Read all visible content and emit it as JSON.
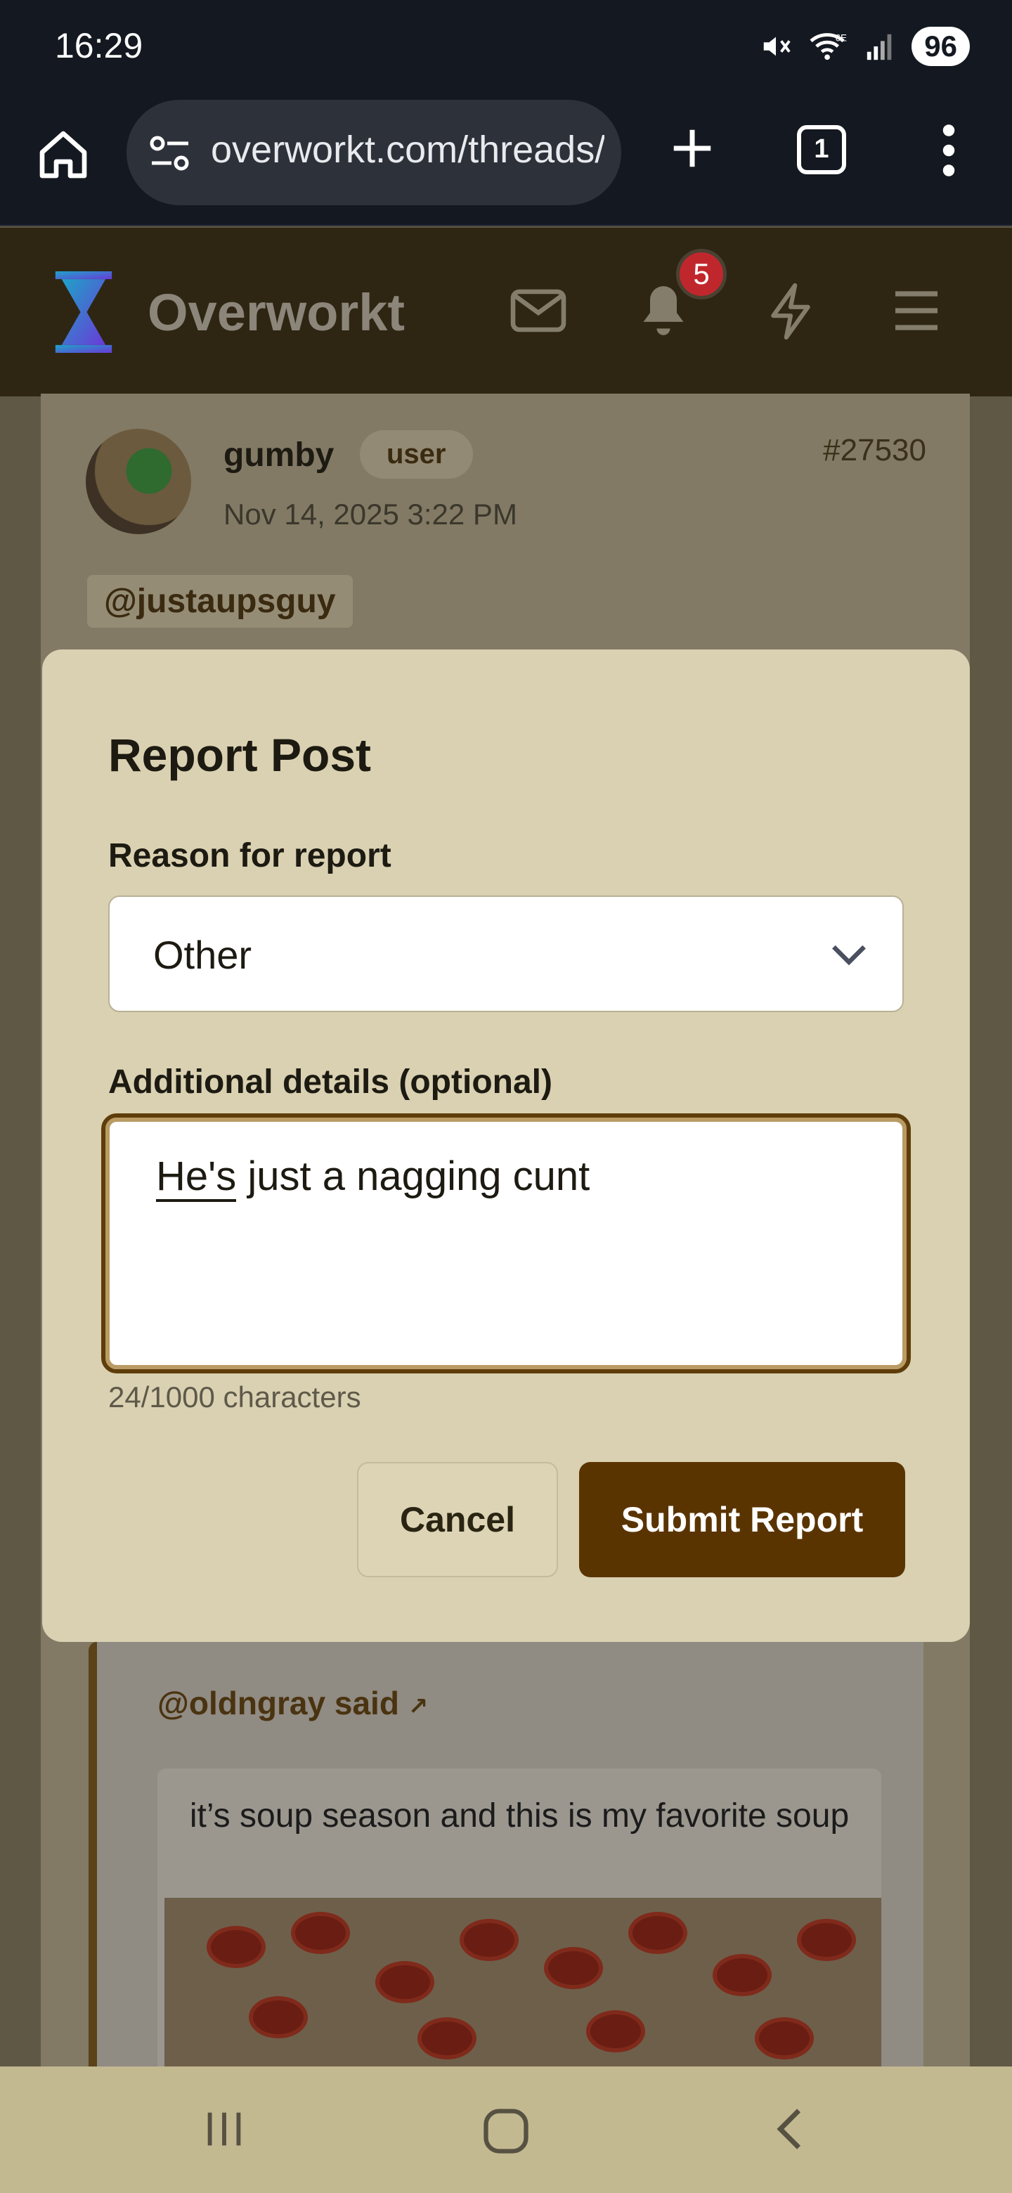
{
  "status_bar": {
    "time": "16:29",
    "battery": "96",
    "network": "6E"
  },
  "browser": {
    "url": "overworkt.com/threads/",
    "tab_count": "1"
  },
  "site": {
    "name": "Overworkt",
    "notification_count": "5"
  },
  "post": {
    "author": "gumby",
    "role": "user",
    "date": "Nov 14, 2025 3:22 PM",
    "number": "#27530",
    "mention": "@justaupsguy"
  },
  "quote": {
    "author_label": "@oldngray said",
    "embed_caption": "it’s soup season and this is my favorite soup"
  },
  "modal": {
    "title": "Report Post",
    "reason_label": "Reason for report",
    "reason_value": "Other",
    "details_label": "Additional details (optional)",
    "details_spellword": "He's",
    "details_rest": " just a nagging cunt",
    "char_count": "24/1000 characters",
    "cancel_label": "Cancel",
    "submit_label": "Submit Report"
  },
  "colors": {
    "brand": "#5a3400",
    "modal_bg": "#d9d1b1",
    "badge": "#c0272d"
  }
}
